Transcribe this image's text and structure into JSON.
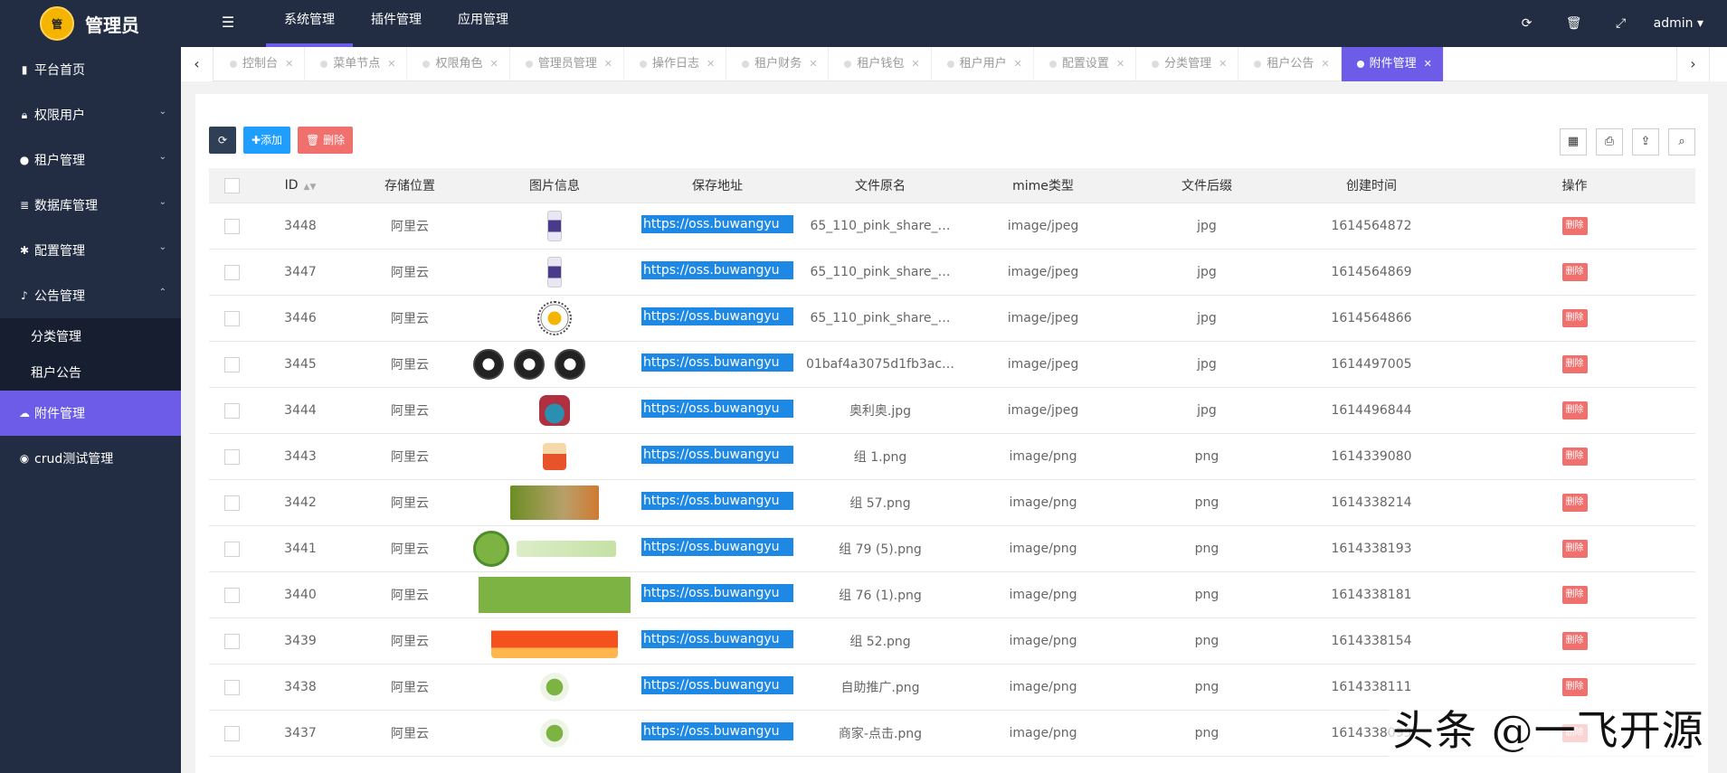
{
  "app": {
    "title": "管理员",
    "logo_text": "管"
  },
  "topnav": [
    {
      "label": "系统管理",
      "active": true
    },
    {
      "label": "插件管理",
      "active": false
    },
    {
      "label": "应用管理",
      "active": false
    }
  ],
  "top_icons": [
    "refresh-icon",
    "trash-icon",
    "fullscreen-icon"
  ],
  "user": {
    "name": "admin ▾"
  },
  "sidebar": [
    {
      "label": "平台首页",
      "icon": "bar-chart-icon",
      "chev": ""
    },
    {
      "label": "权限用户",
      "icon": "lock-icon",
      "chev": "⌄"
    },
    {
      "label": "租户管理",
      "icon": "user-icon",
      "chev": "⌄"
    },
    {
      "label": "数据库管理",
      "icon": "database-icon",
      "chev": "⌄"
    },
    {
      "label": "配置管理",
      "icon": "gear-icon",
      "chev": "⌄"
    },
    {
      "label": "公告管理",
      "icon": "bell-icon",
      "chev": "⌃"
    }
  ],
  "sidebar_sub": [
    {
      "label": "分类管理"
    },
    {
      "label": "租户公告"
    }
  ],
  "sidebar_bottom": [
    {
      "label": "附件管理",
      "icon": "cloud-upload-icon",
      "active": true
    },
    {
      "label": "crud测试管理",
      "icon": "dashboard-icon",
      "active": false
    }
  ],
  "tabs": [
    {
      "label": "控制台"
    },
    {
      "label": "菜单节点"
    },
    {
      "label": "权限角色"
    },
    {
      "label": "管理员管理"
    },
    {
      "label": "操作日志"
    },
    {
      "label": "租户财务"
    },
    {
      "label": "租户钱包"
    },
    {
      "label": "租户用户"
    },
    {
      "label": "配置设置"
    },
    {
      "label": "分类管理"
    },
    {
      "label": "租户公告"
    },
    {
      "label": "附件管理",
      "active": true
    }
  ],
  "toolbar": {
    "add_label": "✚添加",
    "delete_label": "🗑 删除"
  },
  "table": {
    "headers": [
      "ID",
      "存储位置",
      "图片信息",
      "保存地址",
      "文件原名",
      "mime类型",
      "文件后缀",
      "创建时间",
      "操作"
    ],
    "delete_label": "删除",
    "rows": [
      {
        "id": "3448",
        "loc": "阿里云",
        "thumb": "t-phone",
        "url": "https://oss.buwangyu",
        "name": "65_110_pink_share_…",
        "mime": "image/jpeg",
        "ext": "jpg",
        "time": "1614564872"
      },
      {
        "id": "3447",
        "loc": "阿里云",
        "thumb": "t-phone",
        "url": "https://oss.buwangyu",
        "name": "65_110_pink_share_…",
        "mime": "image/jpeg",
        "ext": "jpg",
        "time": "1614564869"
      },
      {
        "id": "3446",
        "loc": "阿里云",
        "thumb": "t-qr",
        "url": "https://oss.buwangyu",
        "name": "65_110_pink_share_…",
        "mime": "image/jpeg",
        "ext": "jpg",
        "time": "1614564866"
      },
      {
        "id": "3445",
        "loc": "阿里云",
        "thumb": "t-badges",
        "url": "https://oss.buwangyu",
        "name": "01baf4a3075d1fb3ac…",
        "mime": "image/jpeg",
        "ext": "jpg",
        "time": "1614497005"
      },
      {
        "id": "3444",
        "loc": "阿里云",
        "thumb": "t-gift",
        "url": "https://oss.buwangyu",
        "name": "奥利奥.jpg",
        "mime": "image/jpeg",
        "ext": "jpg",
        "time": "1614496844"
      },
      {
        "id": "3443",
        "loc": "阿里云",
        "thumb": "t-bag",
        "url": "https://oss.buwangyu",
        "name": "组 1.png",
        "mime": "image/png",
        "ext": "png",
        "time": "1614339080"
      },
      {
        "id": "3442",
        "loc": "阿里云",
        "thumb": "t-banner",
        "url": "https://oss.buwangyu",
        "name": "组 57.png",
        "mime": "image/png",
        "ext": "png",
        "time": "1614338214"
      },
      {
        "id": "3441",
        "loc": "阿里云",
        "thumb": "t-organic",
        "url": "https://oss.buwangyu",
        "name": "组 79 (5).png",
        "mime": "image/png",
        "ext": "png",
        "time": "1614338193"
      },
      {
        "id": "3440",
        "loc": "阿里云",
        "thumb": "t-green",
        "url": "https://oss.buwangyu",
        "name": "组 76 (1).png",
        "mime": "image/png",
        "ext": "png",
        "time": "1614338181"
      },
      {
        "id": "3439",
        "loc": "阿里云",
        "thumb": "t-red",
        "url": "https://oss.buwangyu",
        "name": "组 52.png",
        "mime": "image/png",
        "ext": "png",
        "time": "1614338154"
      },
      {
        "id": "3438",
        "loc": "阿里云",
        "thumb": "t-circle",
        "url": "https://oss.buwangyu",
        "name": "自助推广.png",
        "mime": "image/png",
        "ext": "png",
        "time": "1614338111"
      },
      {
        "id": "3437",
        "loc": "阿里云",
        "thumb": "t-circle",
        "url": "https://oss.buwangyu",
        "name": "商家-点击.png",
        "mime": "image/png",
        "ext": "png",
        "time": "1614338093"
      }
    ]
  },
  "watermark": "头条 @一飞开源",
  "colors": {
    "sidebar": "#222d44",
    "accent": "#6c5ce7",
    "url_bg": "#1e88e5",
    "delete": "#f0706e",
    "add": "#1e9fff"
  }
}
